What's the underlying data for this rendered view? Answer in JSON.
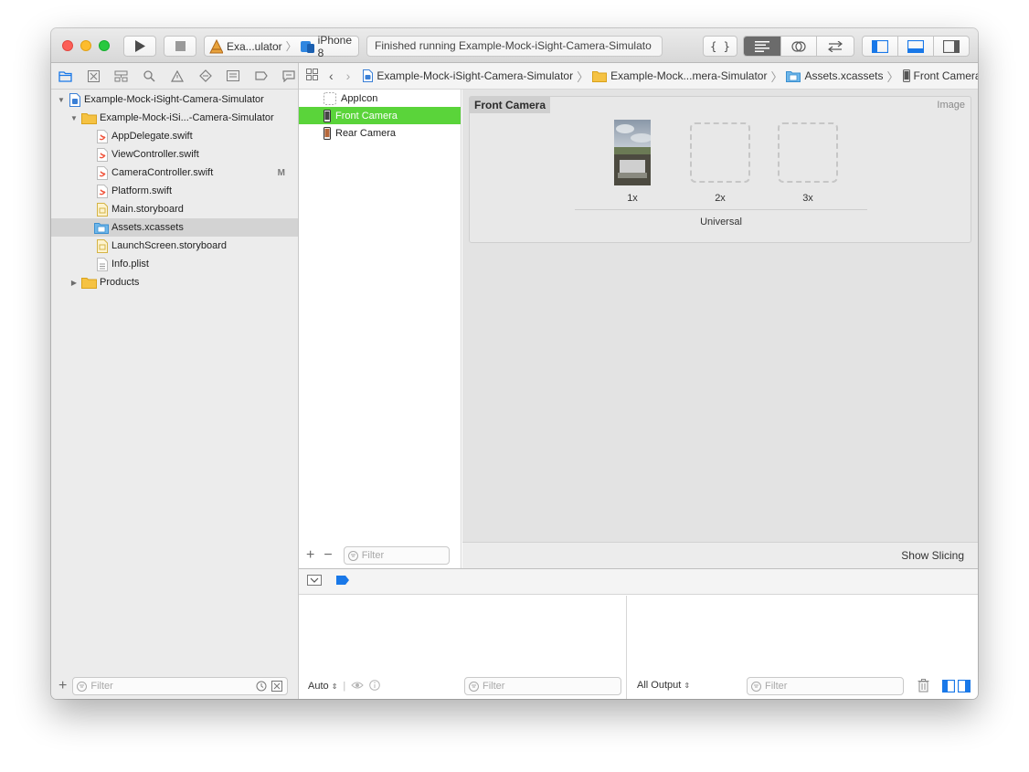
{
  "toolbar": {
    "scheme_name": "Exa...ulator",
    "destination": "iPhone 8",
    "status": "Finished running Example-Mock-iSight-Camera-Simulato",
    "colors": {
      "close": "#fc5f57",
      "minimize": "#fdbc2e",
      "zoom": "#28c840",
      "selection_blue": "#1978e8"
    }
  },
  "navigator": {
    "tree": [
      {
        "label": "Example-Mock-iSight-Camera-Simulator",
        "icon": "project-icon"
      },
      {
        "label": "Example-Mock-iSi...-Camera-Simulator",
        "icon": "folder-icon"
      },
      {
        "label": "AppDelegate.swift",
        "icon": "swift-file-icon"
      },
      {
        "label": "ViewController.swift",
        "icon": "swift-file-icon"
      },
      {
        "label": "CameraController.swift",
        "icon": "swift-file-icon",
        "badge": "M"
      },
      {
        "label": "Platform.swift",
        "icon": "swift-file-icon"
      },
      {
        "label": "Main.storyboard",
        "icon": "storyboard-icon"
      },
      {
        "label": "Assets.xcassets",
        "icon": "assets-folder-icon",
        "selected": true
      },
      {
        "label": "LaunchScreen.storyboard",
        "icon": "storyboard-icon"
      },
      {
        "label": "Info.plist",
        "icon": "plist-icon"
      },
      {
        "label": "Products",
        "icon": "folder-icon"
      }
    ],
    "filter_placeholder": "Filter"
  },
  "jumpbar": {
    "crumbs": [
      "Example-Mock-iSight-Camera-Simulator",
      "Example-Mock...mera-Simulator",
      "Assets.xcassets",
      "Front Camera"
    ]
  },
  "assets": {
    "items": [
      {
        "label": "AppIcon"
      },
      {
        "label": "Front Camera",
        "selected": true
      },
      {
        "label": "Rear Camera"
      }
    ],
    "filter_placeholder": "Filter",
    "selected_color": "#5ad43a"
  },
  "imageset": {
    "title": "Front Camera",
    "kind": "Image",
    "slots": [
      "1x",
      "2x",
      "3x"
    ],
    "device": "Universal",
    "show_slicing": "Show Slicing"
  },
  "debug": {
    "auto_label": "Auto",
    "output_label": "All Output",
    "filter_placeholder": "Filter"
  }
}
